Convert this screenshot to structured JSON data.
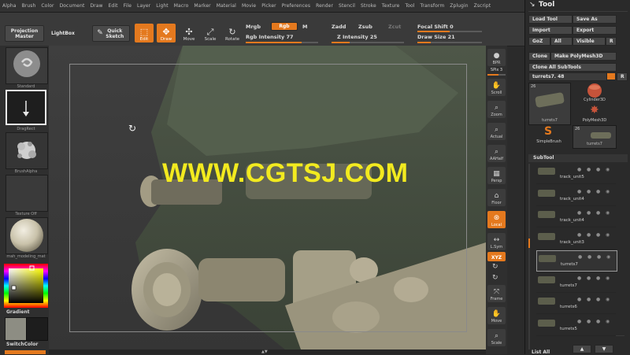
{
  "menu": [
    "Alpha",
    "Brush",
    "Color",
    "Document",
    "Draw",
    "Edit",
    "File",
    "Layer",
    "Light",
    "Macro",
    "Marker",
    "Material",
    "Movie",
    "Picker",
    "Preferences",
    "Render",
    "Stencil",
    "Stroke",
    "Texture",
    "Tool",
    "Transform",
    "Zplugin",
    "Zscript"
  ],
  "shelf": {
    "projection_master": "Projection Master",
    "lightbox": "LightBox",
    "quick_sketch": "Quick Sketch",
    "edit": "Edit",
    "draw": "Draw",
    "move": "Move",
    "scale": "Scale",
    "rotate": "Rotate",
    "mrgb": "Mrgb",
    "rgb": "Rgb",
    "m": "M",
    "rgb_intensity": "Rgb Intensity 77",
    "zadd": "Zadd",
    "zsub": "Zsub",
    "zcut": "Zcut",
    "z_intensity": "Z Intensity 25",
    "focal_shift": "Focal Shift 0",
    "draw_size": "Draw Size 21"
  },
  "sliders": {
    "rgb_intensity": 0.77,
    "z_intensity": 0.25,
    "focal_shift": 0.5,
    "draw_size": 0.21
  },
  "left": {
    "brush_label": "Standard",
    "stroke_label": "DragRect",
    "alpha_label": "BrushAlpha",
    "texture_label": "Texture Off",
    "material_label": "mah_modeling_mat",
    "gradient": "Gradient",
    "switch_color": "SwitchColor"
  },
  "watermark": "WWW.CGTSJ.COM",
  "right_tools": {
    "bpr": "BPR",
    "spix": "SPix 3",
    "scroll": "Scroll",
    "zoom": "Zoom",
    "actual": "Actual",
    "aahalf": "AAHalf",
    "persp": "Persp",
    "floor": "Floor",
    "local": "Local",
    "lsym": "L.Sym",
    "xyz": "XYZ",
    "frame": "Frame",
    "move": "Move",
    "scale": "Scale"
  },
  "palette": {
    "title": "Tool",
    "load_tool": "Load Tool",
    "save_as": "Save As",
    "import": "Import",
    "export": "Export",
    "goz": "GoZ",
    "all": "All",
    "visible": "Visible",
    "r": "R",
    "clone": "Clone",
    "make_polymesh": "Make PolyMesh3D",
    "clone_all": "Clone All SubTools",
    "current_tool": "turrets7. 48",
    "thumb_count_a": "26",
    "thumb_name_a": "turrets7",
    "cylinder": "Cylinder3D",
    "polymesh": "PolyMesh3D",
    "simplebrush": "SimpleBrush",
    "thumb_count_b": "26",
    "thumb_name_b": "turrets7",
    "subtool": "SubTool",
    "subtools": [
      "track_unit5",
      "track_unit4",
      "track_unit4",
      "track_unit3",
      "turrets7",
      "turrets7",
      "turrets6",
      "turrets5"
    ],
    "list_all": "List All"
  },
  "colors": {
    "accent": "#e4791e",
    "watermark": "#f2ea1f",
    "background": "#2b2b2b"
  }
}
